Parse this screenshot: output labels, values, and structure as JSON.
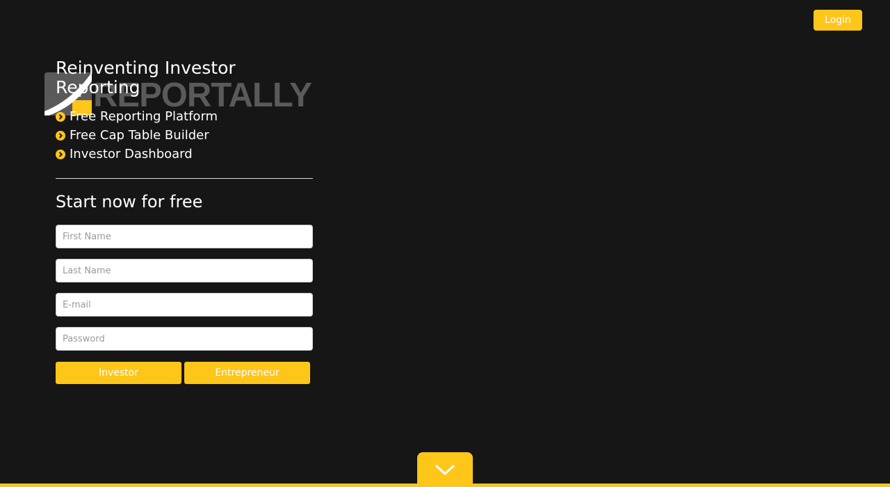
{
  "header": {
    "login_label": "Login"
  },
  "logo": {
    "wordmark": "REPORTALLY",
    "icon": "reportally-check-logo"
  },
  "hero": {
    "headline": "Reinventing Investor Reporting",
    "features": [
      {
        "label": "Free Reporting Platform",
        "icon": "chevron-circle-right-icon"
      },
      {
        "label": "Free Cap Table Builder",
        "icon": "chevron-circle-right-icon"
      },
      {
        "label": "Investor Dashboard",
        "icon": "chevron-circle-right-icon"
      }
    ]
  },
  "signup": {
    "title": "Start now for free",
    "first_name_placeholder": "First Name",
    "last_name_placeholder": "Last Name",
    "email_placeholder": "E-mail",
    "password_placeholder": "Password",
    "investor_label": "Investor",
    "entrepreneur_label": "Entrepreneur"
  },
  "scroll": {
    "icon": "chevron-down-icon"
  },
  "colors": {
    "background": "#161616",
    "accent": "#ffc61a",
    "text": "#ffffff",
    "logo_gray": "#5a5a5a"
  }
}
